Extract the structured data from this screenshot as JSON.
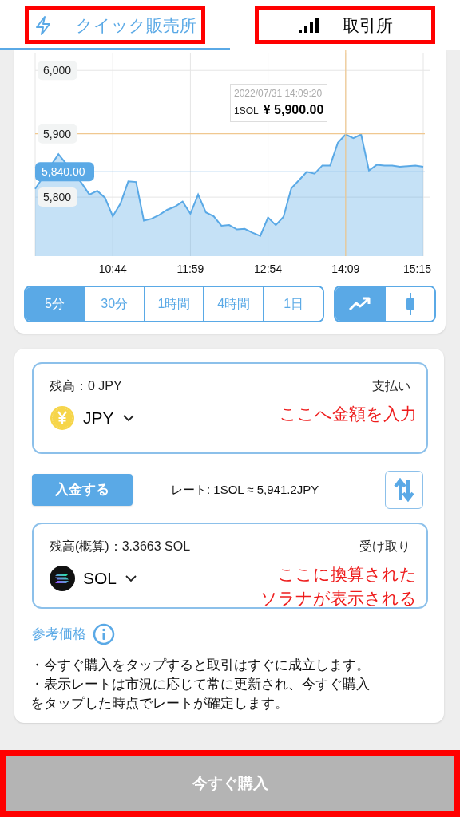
{
  "tabs": [
    {
      "label": "クイック販売所",
      "selected": true,
      "highlighted": true
    },
    {
      "label": "取引所",
      "selected": false,
      "highlighted": true
    }
  ],
  "chart": {
    "chart_data": {
      "type": "area",
      "categories": [
        null,
        null,
        null,
        null,
        null,
        null,
        null,
        null,
        null,
        null,
        "10:44",
        null,
        null,
        null,
        null,
        null,
        null,
        null,
        null,
        null,
        "11:59",
        null,
        null,
        null,
        null,
        null,
        null,
        null,
        null,
        null,
        "12:54",
        null,
        null,
        null,
        null,
        null,
        null,
        null,
        null,
        null,
        "14:09",
        null,
        null,
        null,
        null,
        null,
        null,
        null,
        null,
        null,
        "15:15"
      ],
      "series": [
        {
          "color": "#5aa9e6",
          "values": [
            5813,
            null,
            null,
            5868,
            null,
            null,
            5822,
            5804,
            5810,
            5799,
            5770,
            5790,
            5825,
            5824,
            5763,
            5766,
            5772,
            5780,
            5785,
            5793,
            5774,
            5804,
            5776,
            5770,
            5755,
            5756,
            5749,
            5750,
            5744,
            5739,
            5768,
            5756,
            5769,
            5814,
            5827,
            5840,
            5837,
            5850,
            5850,
            5886,
            5899,
            5893,
            5899,
            5842,
            5851,
            5850,
            5850,
            5848,
            5849,
            5850,
            5848
          ]
        }
      ],
      "ylim": [
        5707,
        6028
      ],
      "yticks": [
        {
          "value": 5800,
          "label": "5,800"
        },
        {
          "value": 5900,
          "label": "5,900"
        },
        {
          "value": 6000,
          "label": "6,000"
        }
      ],
      "grid": true,
      "ref_lines": [
        {
          "axis": "y",
          "value": 5840,
          "label": "5,840.00",
          "color": "#8cc0ea"
        }
      ]
    },
    "tooltip": {
      "time": "2022/07/31 14:09:20",
      "unit": "1SOL",
      "price": "¥ 5,900.00"
    }
  },
  "intervals": [
    {
      "label": "5分",
      "selected": true
    },
    {
      "label": "30分",
      "selected": false
    },
    {
      "label": "1時間",
      "selected": false
    },
    {
      "label": "4時間",
      "selected": false
    },
    {
      "label": "1日",
      "selected": false
    }
  ],
  "chart_types": [
    {
      "kind": "line",
      "selected": true
    },
    {
      "kind": "candle",
      "selected": false
    }
  ],
  "pay_box": {
    "balance": "残高：0 JPY",
    "role": "支払い",
    "currency": "JPY",
    "note": [
      "ここへ金額を入力"
    ]
  },
  "deposit_button": "入金する",
  "rate": "レート: 1SOL ≈ 5,941.2JPY",
  "receive_box": {
    "balance": "残高(概算)：3.3663 SOL",
    "role": "受け取り",
    "currency": "SOL",
    "note": [
      "ここに換算された",
      "ソラナが表示される"
    ]
  },
  "reference_price": "参考価格",
  "notes": [
    "・今すぐ購入をタップすると取引はすぐに成立します。",
    "・表示レートは市況に応じて常に更新され、今すぐ購入をタップした時点でレートが確定します。"
  ],
  "buy_button": {
    "label": "今すぐ購入",
    "disabled": true,
    "highlighted": true
  }
}
